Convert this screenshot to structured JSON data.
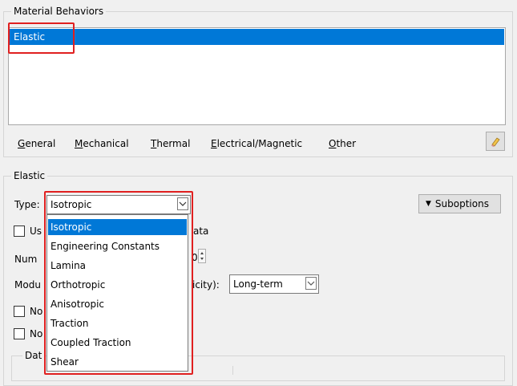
{
  "material_behaviors": {
    "title": "Material Behaviors",
    "items": [
      "Elastic"
    ]
  },
  "menu": {
    "general": {
      "mnemonic": "G",
      "rest": "eneral"
    },
    "mechanical": {
      "mnemonic": "M",
      "rest": "echanical"
    },
    "thermal": {
      "mnemonic": "T",
      "rest": "hermal"
    },
    "electrical": {
      "mnemonic": "E",
      "rest": "lectrical/Magnetic"
    },
    "other": {
      "mnemonic": "O",
      "rest": "ther"
    }
  },
  "elastic": {
    "title": "Elastic",
    "type_label": "Type:",
    "type_value": "Isotropic",
    "suboptions_label": "Suboptions",
    "use_label_partial": "Us",
    "use_label_tail": "ata",
    "number_label_partial": "Num",
    "number_value_partial": "0",
    "moduli_label_partial": "Modu",
    "moduli_label_tail": "icity):",
    "moduli_value": "Long-term",
    "no_label_1_partial": "No",
    "no_label_2_partial": "No",
    "data_label_partial": "Dat"
  },
  "type_options": [
    "Isotropic",
    "Engineering Constants",
    "Lamina",
    "Orthotropic",
    "Anisotropic",
    "Traction",
    "Coupled Traction",
    "Shear"
  ],
  "colors": {
    "selection": "#0078d7",
    "highlight_box": "#e02020"
  }
}
